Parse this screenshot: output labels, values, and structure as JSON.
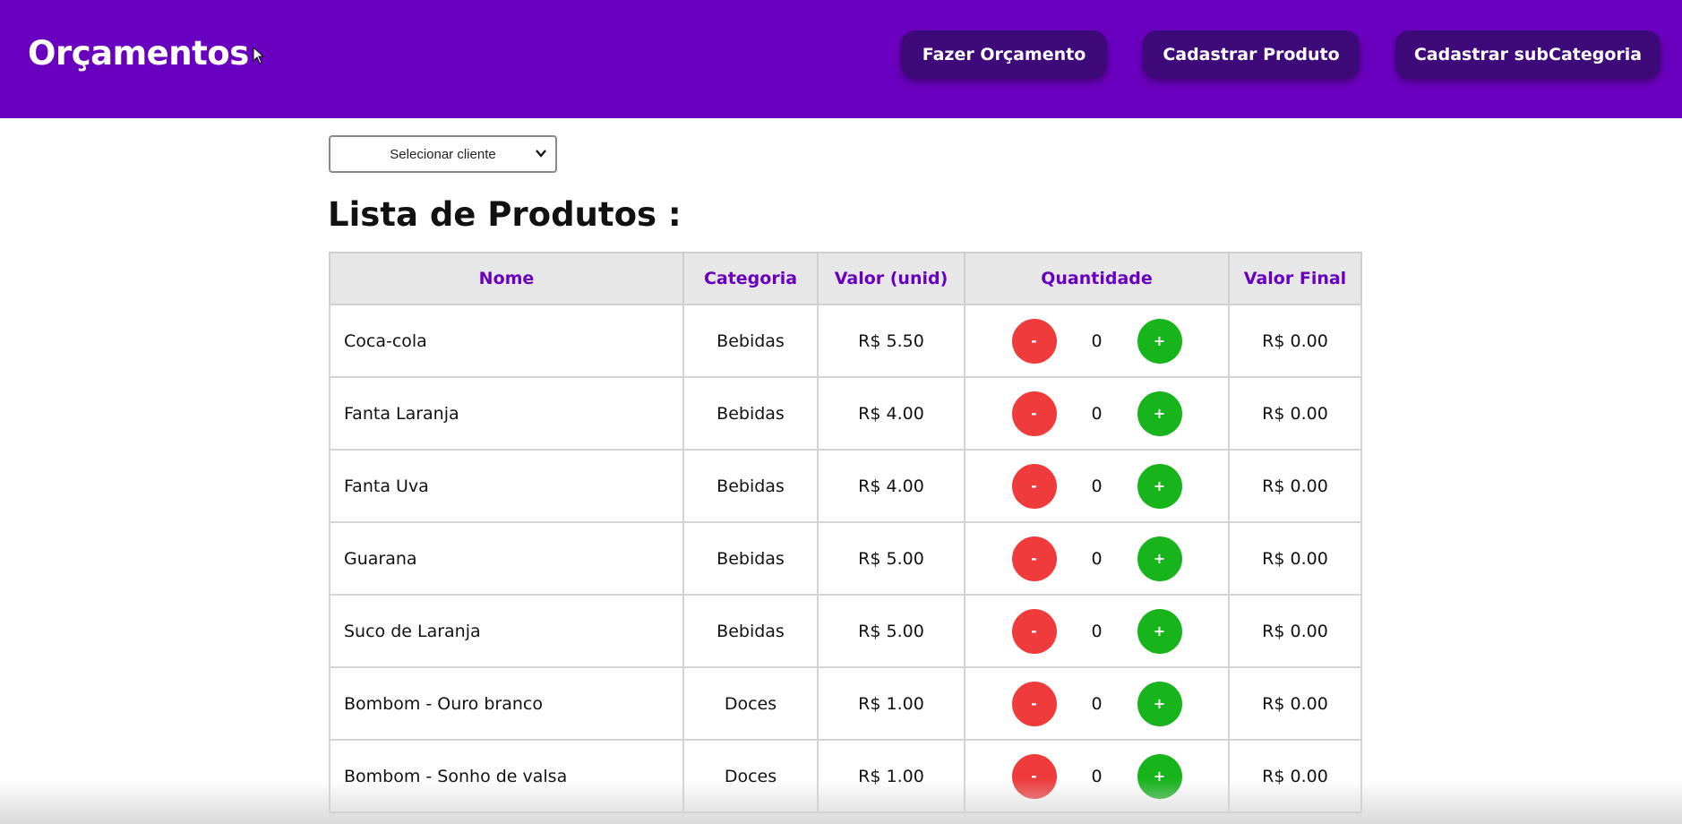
{
  "header": {
    "brand": "Orçamentos",
    "nav": {
      "fazer_orcamento": "Fazer Orçamento",
      "cadastrar_produto": "Cadastrar Produto",
      "cadastrar_subcategoria": "Cadastrar subCategoria"
    }
  },
  "client_select": {
    "selected": "Selecionar cliente"
  },
  "list_title": "Lista de Produtos :",
  "table": {
    "headers": {
      "nome": "Nome",
      "categoria": "Categoria",
      "valor_unid": "Valor (unid)",
      "quantidade": "Quantidade",
      "valor_final": "Valor Final"
    },
    "rows": [
      {
        "nome": "Coca-cola",
        "categoria": "Bebidas",
        "valor": "R$ 5.50",
        "quantidade": "0",
        "valor_final": "R$ 0.00",
        "minus": "-",
        "plus": "+"
      },
      {
        "nome": "Fanta Laranja",
        "categoria": "Bebidas",
        "valor": "R$ 4.00",
        "quantidade": "0",
        "valor_final": "R$ 0.00",
        "minus": "-",
        "plus": "+"
      },
      {
        "nome": "Fanta Uva",
        "categoria": "Bebidas",
        "valor": "R$ 4.00",
        "quantidade": "0",
        "valor_final": "R$ 0.00",
        "minus": "-",
        "plus": "+"
      },
      {
        "nome": "Guarana",
        "categoria": "Bebidas",
        "valor": "R$ 5.00",
        "quantidade": "0",
        "valor_final": "R$ 0.00",
        "minus": "-",
        "plus": "+"
      },
      {
        "nome": "Suco de Laranja",
        "categoria": "Bebidas",
        "valor": "R$ 5.00",
        "quantidade": "0",
        "valor_final": "R$ 0.00",
        "minus": "-",
        "plus": "+"
      },
      {
        "nome": "Bombom - Ouro branco",
        "categoria": "Doces",
        "valor": "R$ 1.00",
        "quantidade": "0",
        "valor_final": "R$ 0.00",
        "minus": "-",
        "plus": "+"
      },
      {
        "nome": "Bombom - Sonho de valsa",
        "categoria": "Doces",
        "valor": "R$ 1.00",
        "quantidade": "0",
        "valor_final": "R$ 0.00",
        "minus": "-",
        "plus": "+"
      }
    ]
  },
  "colors": {
    "header_bg": "#6a00bf",
    "nav_button_bg": "#3e0a7a",
    "minus_button": "#ef3b3b",
    "plus_button": "#17b41c",
    "table_header_text": "#6a00bf"
  },
  "icons": {
    "cursor": "mouse-pointer-icon",
    "select_arrow": "chevron-down-icon"
  }
}
